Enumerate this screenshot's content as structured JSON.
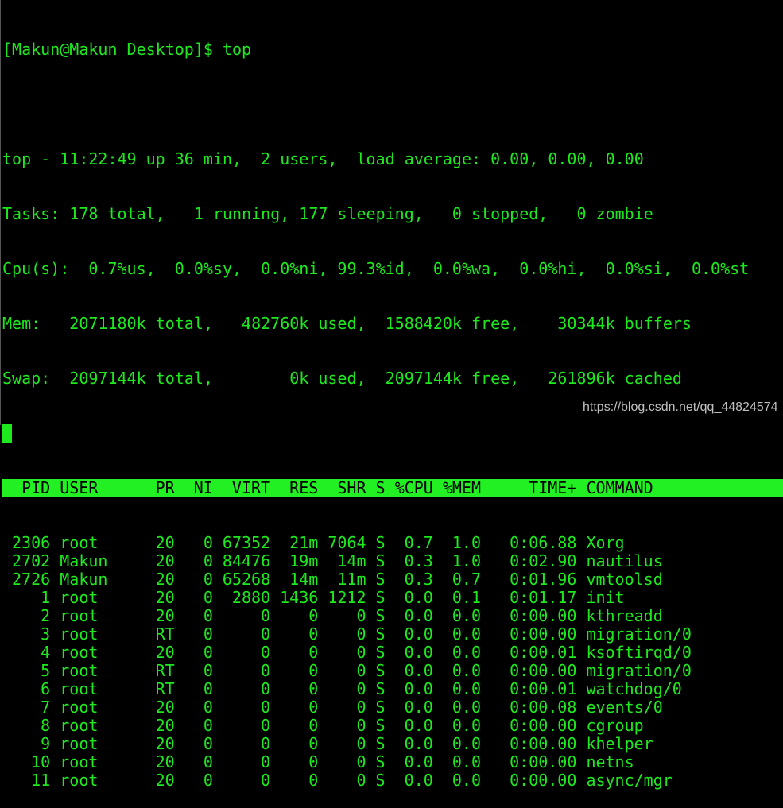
{
  "colors": {
    "text": "#1ee81e",
    "header_bg": "#22f022",
    "background": "#000000"
  },
  "prompt": "[Makun@Makun Desktop]$ top",
  "summary": [
    "top - 11:22:49 up 36 min,  2 users,  load average: 0.00, 0.00, 0.00",
    "Tasks: 178 total,   1 running, 177 sleeping,   0 stopped,   0 zombie",
    "Cpu(s):  0.7%us,  0.0%sy,  0.0%ni, 99.3%id,  0.0%wa,  0.0%hi,  0.0%si,  0.0%st",
    "Mem:   2071180k total,   482760k used,  1588420k free,    30344k buffers",
    "Swap:  2097144k total,        0k used,  2097144k free,   261896k cached"
  ],
  "columns": [
    "PID",
    "USER",
    "PR",
    "NI",
    "VIRT",
    "RES",
    "SHR",
    "S",
    "%CPU",
    "%MEM",
    "TIME+",
    "COMMAND"
  ],
  "rows": [
    [
      "2306",
      "root",
      "20",
      "0",
      "67352",
      "21m",
      "7064",
      "S",
      "0.7",
      "1.0",
      "0:06.88",
      "Xorg"
    ],
    [
      "2702",
      "Makun",
      "20",
      "0",
      "84476",
      "19m",
      "14m",
      "S",
      "0.3",
      "1.0",
      "0:02.90",
      "nautilus"
    ],
    [
      "2726",
      "Makun",
      "20",
      "0",
      "65268",
      "14m",
      "11m",
      "S",
      "0.3",
      "0.7",
      "0:01.96",
      "vmtoolsd"
    ],
    [
      "1",
      "root",
      "20",
      "0",
      "2880",
      "1436",
      "1212",
      "S",
      "0.0",
      "0.1",
      "0:01.17",
      "init"
    ],
    [
      "2",
      "root",
      "20",
      "0",
      "0",
      "0",
      "0",
      "S",
      "0.0",
      "0.0",
      "0:00.00",
      "kthreadd"
    ],
    [
      "3",
      "root",
      "RT",
      "0",
      "0",
      "0",
      "0",
      "S",
      "0.0",
      "0.0",
      "0:00.00",
      "migration/0"
    ],
    [
      "4",
      "root",
      "20",
      "0",
      "0",
      "0",
      "0",
      "S",
      "0.0",
      "0.0",
      "0:00.01",
      "ksoftirqd/0"
    ],
    [
      "5",
      "root",
      "RT",
      "0",
      "0",
      "0",
      "0",
      "S",
      "0.0",
      "0.0",
      "0:00.00",
      "migration/0"
    ],
    [
      "6",
      "root",
      "RT",
      "0",
      "0",
      "0",
      "0",
      "S",
      "0.0",
      "0.0",
      "0:00.01",
      "watchdog/0"
    ],
    [
      "7",
      "root",
      "20",
      "0",
      "0",
      "0",
      "0",
      "S",
      "0.0",
      "0.0",
      "0:00.08",
      "events/0"
    ],
    [
      "8",
      "root",
      "20",
      "0",
      "0",
      "0",
      "0",
      "S",
      "0.0",
      "0.0",
      "0:00.00",
      "cgroup"
    ],
    [
      "9",
      "root",
      "20",
      "0",
      "0",
      "0",
      "0",
      "S",
      "0.0",
      "0.0",
      "0:00.00",
      "khelper"
    ],
    [
      "10",
      "root",
      "20",
      "0",
      "0",
      "0",
      "0",
      "S",
      "0.0",
      "0.0",
      "0:00.00",
      "netns"
    ],
    [
      "11",
      "root",
      "20",
      "0",
      "0",
      "0",
      "0",
      "S",
      "0.0",
      "0.0",
      "0:00.00",
      "async/mgr"
    ]
  ],
  "watermark": "https://blog.csdn.net/qq_44824574"
}
